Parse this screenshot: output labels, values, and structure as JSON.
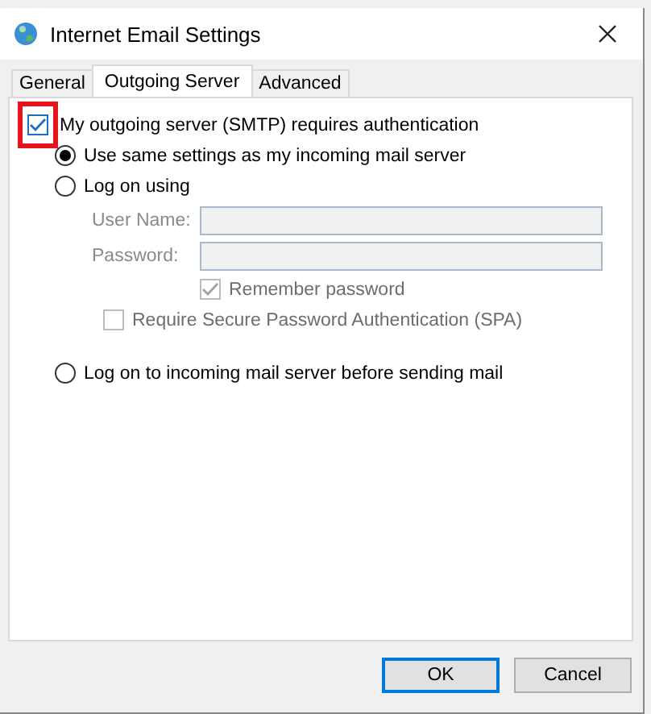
{
  "window": {
    "title": "Internet Email Settings"
  },
  "tabs": [
    {
      "label": "General",
      "selected": false
    },
    {
      "label": "Outgoing Server",
      "selected": true
    },
    {
      "label": "Advanced",
      "selected": false
    }
  ],
  "auth_checkbox": {
    "label": "My outgoing server (SMTP) requires authentication",
    "checked": true,
    "highlighted": true
  },
  "options": [
    {
      "label": "Use same settings as my incoming mail server",
      "selected": true
    },
    {
      "label": "Log on using",
      "selected": false
    }
  ],
  "fields": [
    {
      "label": "User Name:",
      "disabled": true
    },
    {
      "label": "Password:",
      "disabled": true
    }
  ],
  "checkboxes": [
    {
      "label": "Remember password",
      "checked": true,
      "disabled": true
    },
    {
      "label": "Require Secure Password Authentication (SPA)",
      "checked": false,
      "disabled": true
    }
  ],
  "last_option": {
    "label": "Log on to incoming mail server before sending mail",
    "selected": false
  },
  "buttons": [
    {
      "label": "OK",
      "default": true
    },
    {
      "label": "Cancel",
      "default": false
    }
  ]
}
